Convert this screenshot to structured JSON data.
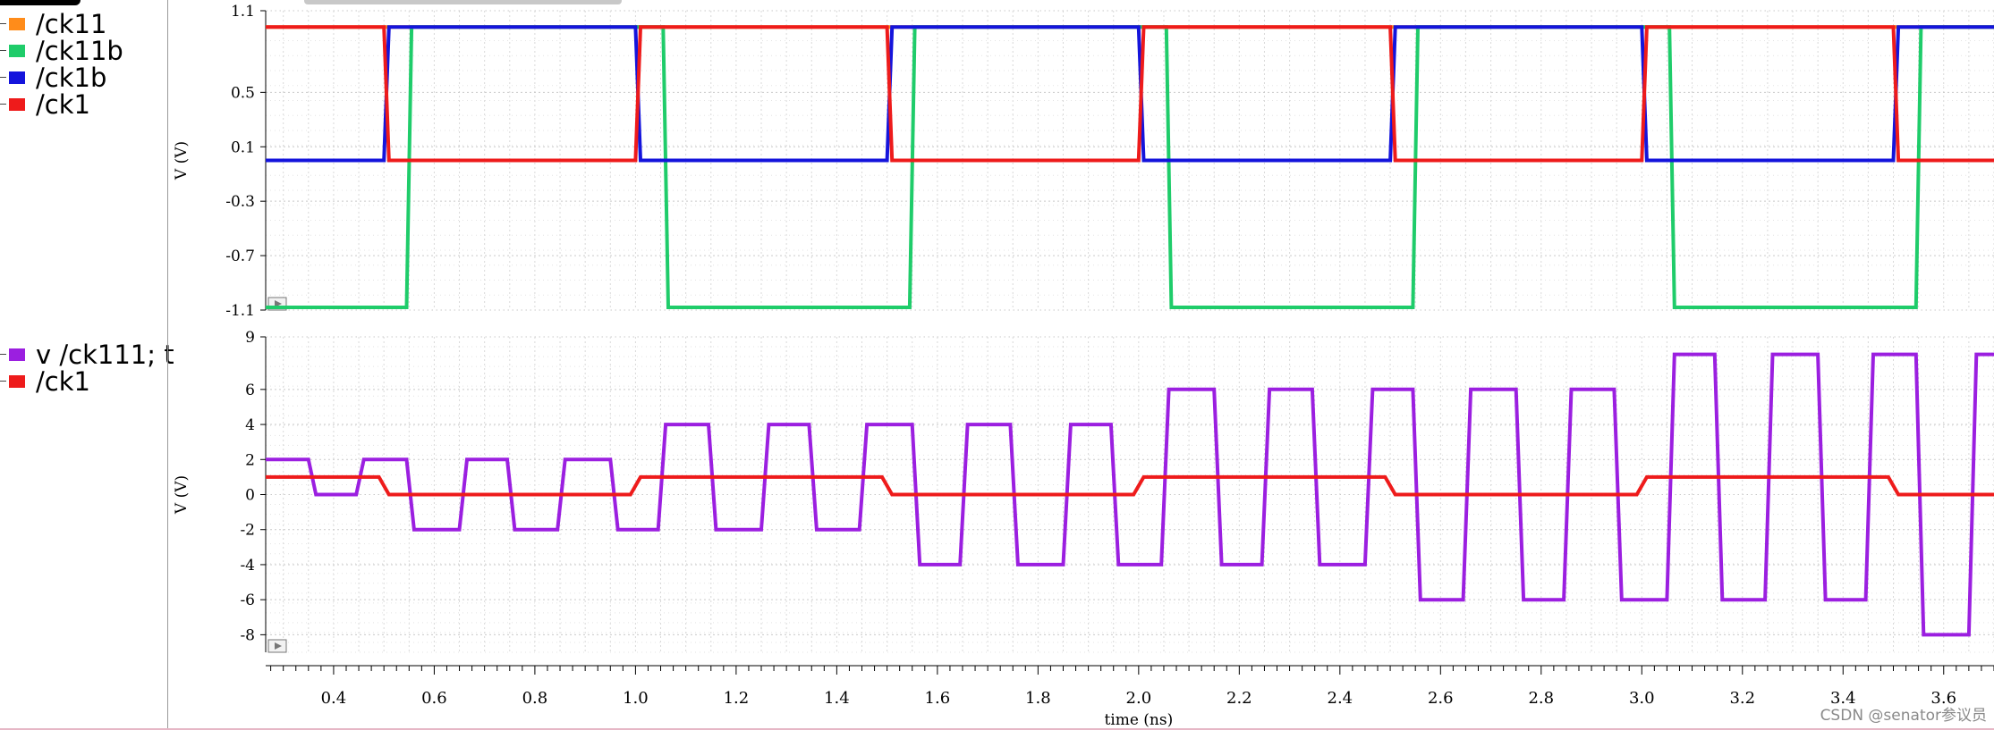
{
  "chart_data": [
    {
      "type": "line",
      "ylabel": "V (V)",
      "xlabel": "",
      "ylim": [
        -1.1,
        1.1
      ],
      "xlim": [
        0.265,
        3.7
      ],
      "y_ticks": [
        "1.1",
        "0.5",
        "0.1",
        "-0.3",
        "-0.7",
        "-1.1"
      ],
      "legend": [
        "/ck11",
        "/ck11b",
        "/ck1b",
        "/ck1"
      ],
      "legend_placement": "left",
      "grid": true,
      "series": [
        {
          "name": "/ck11",
          "color": "#ff8c1a",
          "x": [
            0.265,
            3.7
          ],
          "y": [
            0.98,
            0.98
          ]
        },
        {
          "name": "/ck11b",
          "color": "#1fcc6a",
          "x": [
            0.265,
            0.545,
            0.555,
            3.7
          ],
          "y": [
            -1.08,
            -1.08,
            0.98,
            0.98
          ],
          "period": 1.0,
          "pattern": {
            "x": [
              0.265,
              0.545,
              0.555,
              1.055,
              1.065,
              1.545,
              1.555,
              2.055,
              2.065,
              2.545,
              2.555,
              3.055,
              3.065,
              3.545,
              3.555,
              3.7
            ],
            "y": [
              -1.08,
              -1.08,
              0.98,
              0.98,
              -1.08,
              -1.08,
              0.98,
              0.98,
              -1.08,
              -1.08,
              0.98,
              0.98,
              -1.08,
              -1.08,
              0.98,
              0.98
            ]
          }
        },
        {
          "name": "/ck1b",
          "color": "#1414dc",
          "pattern": {
            "x": [
              0.265,
              0.5,
              0.51,
              1.0,
              1.01,
              1.5,
              1.51,
              2.0,
              2.01,
              2.5,
              2.51,
              3.0,
              3.01,
              3.5,
              3.51,
              3.7
            ],
            "y": [
              0.0,
              0.0,
              0.98,
              0.98,
              0.0,
              0.0,
              0.98,
              0.98,
              0.0,
              0.0,
              0.98,
              0.98,
              0.0,
              0.0,
              0.98,
              0.98
            ]
          }
        },
        {
          "name": "/ck1",
          "color": "#ee1b1b",
          "pattern": {
            "x": [
              0.265,
              0.5,
              0.51,
              1.0,
              1.01,
              1.5,
              1.51,
              2.0,
              2.01,
              2.5,
              2.51,
              3.0,
              3.01,
              3.5,
              3.51,
              3.7
            ],
            "y": [
              0.98,
              0.98,
              0.0,
              0.0,
              0.98,
              0.98,
              0.0,
              0.0,
              0.98,
              0.98,
              0.0,
              0.0,
              0.98,
              0.98,
              0.0,
              0.0
            ]
          }
        }
      ]
    },
    {
      "type": "line",
      "xlabel": "time (ns)",
      "ylabel": "V (V)",
      "ylim": [
        -9,
        9
      ],
      "xlim": [
        0.265,
        3.7
      ],
      "y_ticks": [
        "9",
        "6",
        "4",
        "2",
        "0",
        "-2",
        "-4",
        "-6",
        "-8"
      ],
      "x_ticks": [
        "0.4",
        "0.6",
        "0.8",
        "1.0",
        "1.2",
        "1.4",
        "1.6",
        "1.8",
        "2.0",
        "2.2",
        "2.4",
        "2.6",
        "2.8",
        "3.0",
        "3.2",
        "3.4",
        "3.6"
      ],
      "legend": [
        "v /ck111; t",
        "/ck1"
      ],
      "legend_placement": "left",
      "grid": true,
      "series": [
        {
          "name": "v /ck111; t",
          "color": "#9b1fe0",
          "pattern": {
            "x": [
              0.265,
              0.35,
              0.365,
              0.445,
              0.46,
              0.545,
              0.56,
              0.65,
              0.665,
              0.745,
              0.76,
              0.845,
              0.86,
              0.95,
              0.965,
              1.045,
              1.06,
              1.145,
              1.16,
              1.25,
              1.265,
              1.345,
              1.36,
              1.445,
              1.46,
              1.55,
              1.565,
              1.645,
              1.66,
              1.745,
              1.76,
              1.85,
              1.865,
              1.945,
              1.96,
              2.045,
              2.06,
              2.15,
              2.165,
              2.245,
              2.26,
              2.345,
              2.36,
              2.45,
              2.465,
              2.545,
              2.56,
              2.645,
              2.66,
              2.75,
              2.765,
              2.845,
              2.86,
              2.945,
              2.96,
              3.05,
              3.065,
              3.145,
              3.16,
              3.245,
              3.26,
              3.35,
              3.365,
              3.445,
              3.46,
              3.545,
              3.56,
              3.65,
              3.665,
              3.7
            ],
            "y": [
              2,
              2,
              0,
              0,
              2,
              2,
              -2,
              -2,
              2,
              2,
              -2,
              -2,
              2,
              2,
              -2,
              -2,
              4,
              4,
              -2,
              -2,
              4,
              4,
              -2,
              -2,
              4,
              4,
              -4,
              -4,
              4,
              4,
              -4,
              -4,
              4,
              4,
              -4,
              -4,
              6,
              6,
              -4,
              -4,
              6,
              6,
              -4,
              -4,
              6,
              6,
              -6,
              -6,
              6,
              6,
              -6,
              -6,
              6,
              6,
              -6,
              -6,
              8,
              8,
              -6,
              -6,
              8,
              8,
              -6,
              -6,
              8,
              8,
              -8,
              -8,
              8,
              8
            ]
          }
        },
        {
          "name": "/ck1",
          "color": "#ee1b1b",
          "pattern": {
            "x": [
              0.265,
              0.49,
              0.51,
              0.99,
              1.01,
              1.49,
              1.51,
              1.99,
              2.01,
              2.49,
              2.51,
              2.99,
              3.01,
              3.49,
              3.51,
              3.7
            ],
            "y": [
              1,
              1,
              0,
              0,
              1,
              1,
              0,
              0,
              1,
              1,
              0,
              0,
              1,
              1,
              0,
              0
            ]
          }
        }
      ]
    }
  ],
  "watermark": "CSDN @senator参议员"
}
